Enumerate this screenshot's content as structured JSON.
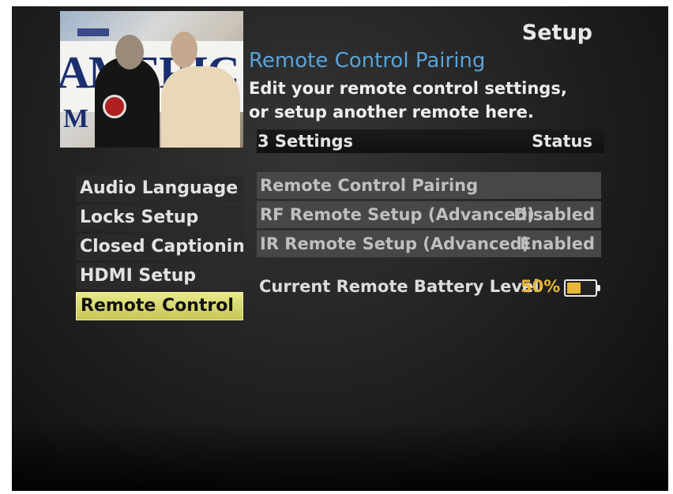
{
  "header": {
    "section_title": "Setup",
    "page_title": "Remote Control Pairing",
    "description": "Edit your remote control settings, or setup another remote here."
  },
  "settings_header": {
    "count_label": "3 Settings",
    "status_label": "Status"
  },
  "left_menu": {
    "items": [
      {
        "label": "Audio Language"
      },
      {
        "label": "Locks Setup"
      },
      {
        "label": "Closed Captioning"
      },
      {
        "label": "HDMI Setup"
      },
      {
        "label": "Remote Control"
      }
    ],
    "selected_index": 4
  },
  "settings": [
    {
      "label": "Remote Control Pairing",
      "status": ""
    },
    {
      "label": "RF Remote Setup (Advanced)",
      "status": "Disabled"
    },
    {
      "label": "IR Remote Setup (Advanced)",
      "status": "Enabled"
    }
  ],
  "battery": {
    "label": "Current Remote Battery Level",
    "percent_text": "50%",
    "level": 0.5
  },
  "preview": {
    "banner_text": "AMERIC",
    "banner_text2": "M"
  },
  "colors": {
    "accent_title": "#5aa3d8",
    "selected_bg": "#d8d870",
    "battery_accent": "#e8b83a"
  }
}
